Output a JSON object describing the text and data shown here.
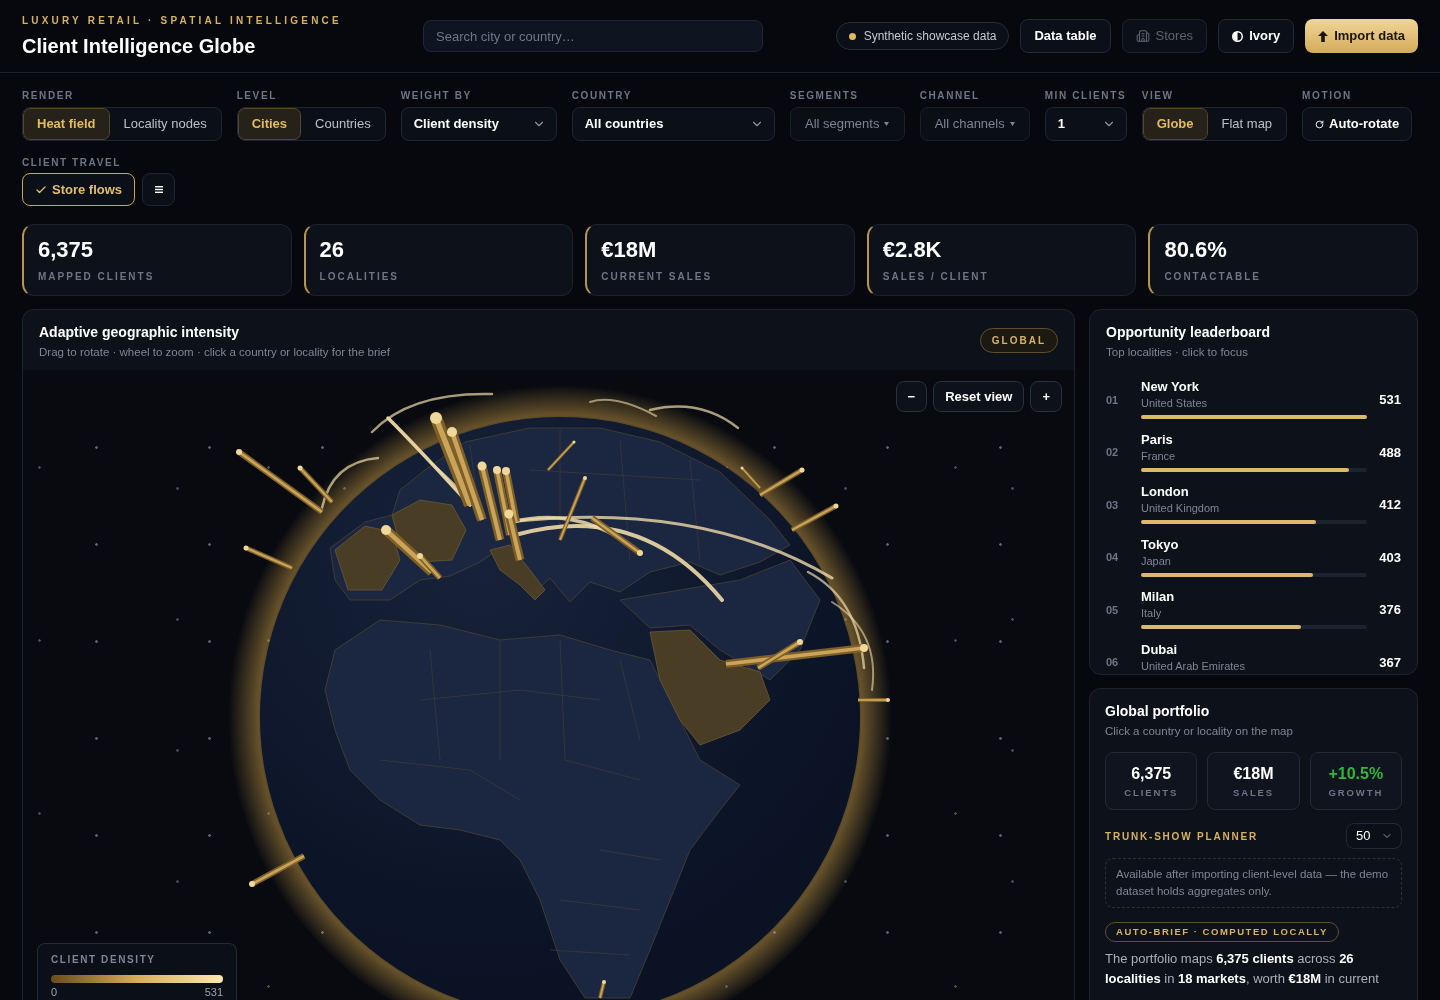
{
  "header": {
    "eyebrow": "LUXURY RETAIL · SPATIAL INTELLIGENCE",
    "title": "Client Intelligence Globe",
    "search": {
      "placeholder": "Search city or country…"
    },
    "data_chip": "Synthetic showcase data",
    "buttons": [
      {
        "label": "Data table",
        "kind": "plain",
        "disabled": false
      },
      {
        "label": "Stores",
        "kind": "stores",
        "disabled": true
      },
      {
        "label": "Ivory",
        "kind": "theme",
        "disabled": false
      },
      {
        "label": "Import data",
        "kind": "primary",
        "disabled": false
      }
    ]
  },
  "filters": [
    {
      "label": "RENDER",
      "kind": "segmented",
      "options": [
        {
          "label": "Heat field",
          "selected": true
        },
        {
          "label": "Locality nodes",
          "selected": false
        }
      ]
    },
    {
      "label": "LEVEL",
      "kind": "segmented",
      "options": [
        {
          "label": "Cities",
          "selected": true
        },
        {
          "label": "Countries",
          "selected": false
        }
      ]
    },
    {
      "label": "WEIGHT BY",
      "kind": "select",
      "value": "Client density"
    },
    {
      "label": "COUNTRY",
      "kind": "select",
      "value": "All countries"
    },
    {
      "label": "SEGMENTS",
      "kind": "multiselect",
      "value": "All segments"
    },
    {
      "label": "CHANNEL",
      "kind": "multiselect",
      "value": "All channels"
    },
    {
      "label": "MIN CLIENTS",
      "kind": "select",
      "value": "1"
    },
    {
      "label": "VIEW",
      "kind": "segmented",
      "options": [
        {
          "label": "Globe",
          "selected": true
        },
        {
          "label": "Flat map",
          "selected": false
        }
      ]
    },
    {
      "label": "MOTION",
      "kind": "action",
      "value": "Auto-rotate"
    }
  ],
  "client_travel": {
    "label": "CLIENT TRAVEL",
    "toggle": {
      "label": "Store flows",
      "on": true
    }
  },
  "kpis": [
    {
      "value": "6,375",
      "label": "MAPPED CLIENTS"
    },
    {
      "value": "26",
      "label": "LOCALITIES"
    },
    {
      "value": "€18M",
      "label": "CURRENT SALES"
    },
    {
      "value": "€2.8K",
      "label": "SALES / CLIENT"
    },
    {
      "value": "80.6%",
      "label": "CONTACTABLE"
    }
  ],
  "map": {
    "title": "Adaptive geographic intensity",
    "subtitle": "Drag to rotate · wheel to zoom · click a country or locality for the brief",
    "badge": "GLOBAL",
    "zoom_controls": [
      {
        "label": "−"
      },
      {
        "label": "Reset view"
      },
      {
        "label": "+"
      }
    ],
    "legend": {
      "title": "CLIENT DENSITY",
      "min": "0",
      "max": "531"
    }
  },
  "leaderboard": {
    "title": "Opportunity leaderboard",
    "subtitle": "Top localities · click to focus",
    "items": [
      {
        "rank": "01",
        "name": "New York",
        "country": "United States",
        "value": "531",
        "level": 1
      },
      {
        "rank": "02",
        "name": "Paris",
        "country": "France",
        "value": "488",
        "level": 0.92
      },
      {
        "rank": "03",
        "name": "London",
        "country": "United Kingdom",
        "value": "412",
        "level": 0.776
      },
      {
        "rank": "04",
        "name": "Tokyo",
        "country": "Japan",
        "value": "403",
        "level": 0.759
      },
      {
        "rank": "05",
        "name": "Milan",
        "country": "Italy",
        "value": "376",
        "level": 0.708
      },
      {
        "rank": "06",
        "name": "Dubai",
        "country": "United Arab Emirates",
        "value": "367"
      }
    ]
  },
  "portfolio": {
    "title": "Global portfolio",
    "subtitle": "Click a country or locality on the map",
    "stats": [
      {
        "value": "6,375",
        "label": "CLIENTS",
        "kind": "neutral"
      },
      {
        "value": "€18M",
        "label": "SALES",
        "kind": "neutral"
      },
      {
        "value": "+10.5%",
        "label": "GROWTH",
        "kind": "positive"
      }
    ],
    "planner": {
      "label": "TRUNK-SHOW PLANNER",
      "value": "50",
      "note": "Available after importing client-level data — the demo dataset holds aggregates only."
    },
    "brief": {
      "badge": "AUTO-BRIEF · COMPUTED LOCALLY",
      "text": "The portfolio maps **6,375 clients** across **26 localities** in **18 markets**, worth **€18M** in current"
    }
  }
}
